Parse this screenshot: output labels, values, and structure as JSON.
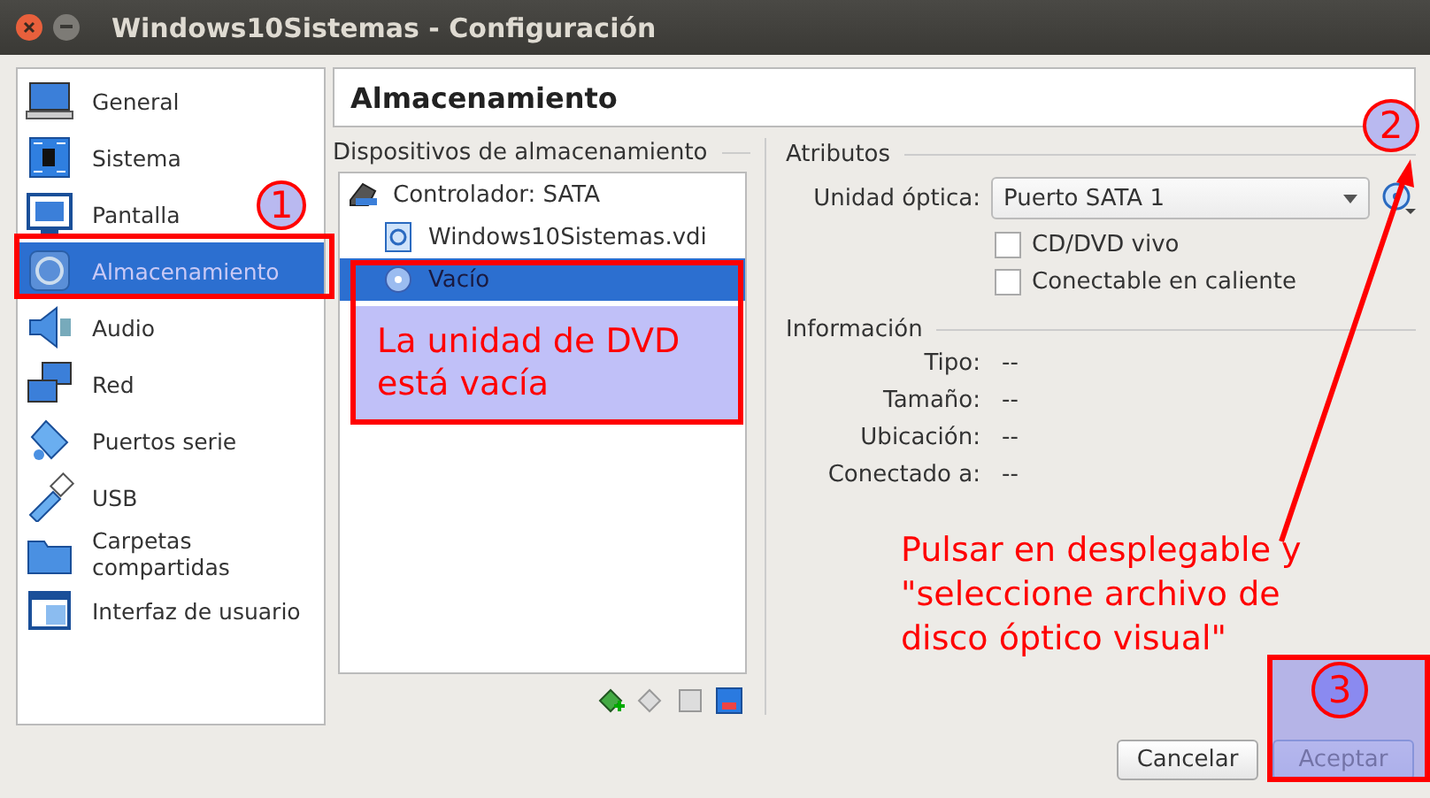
{
  "window": {
    "title": "Windows10Sistemas - Configuración"
  },
  "sidebar": {
    "items": [
      {
        "label": "General",
        "selected": false
      },
      {
        "label": "Sistema",
        "selected": false
      },
      {
        "label": "Pantalla",
        "selected": false
      },
      {
        "label": "Almacenamiento",
        "selected": true
      },
      {
        "label": "Audio",
        "selected": false
      },
      {
        "label": "Red",
        "selected": false
      },
      {
        "label": "Puertos serie",
        "selected": false
      },
      {
        "label": "USB",
        "selected": false
      },
      {
        "label": "Carpetas compartidas",
        "selected": false
      },
      {
        "label": "Interfaz de usuario",
        "selected": false
      }
    ]
  },
  "page_title": "Almacenamiento",
  "storage": {
    "heading": "Dispositivos de almacenamiento",
    "tree": [
      {
        "label": "Controlador: SATA",
        "selected": false,
        "children": [
          {
            "label": "Windows10Sistemas.vdi",
            "kind": "disk",
            "selected": false
          },
          {
            "label": "Vacío",
            "kind": "optical",
            "selected": true
          }
        ]
      }
    ]
  },
  "attributes": {
    "heading": "Atributos",
    "optical_drive": {
      "label": "Unidad óptica:",
      "value": "Puerto SATA 1"
    },
    "checkboxes": [
      {
        "label": "CD/DVD vivo",
        "checked": false
      },
      {
        "label": "Conectable en caliente",
        "checked": false
      }
    ]
  },
  "information": {
    "heading": "Información",
    "rows": [
      {
        "label": "Tipo:",
        "value": "--"
      },
      {
        "label": "Tamaño:",
        "value": "--"
      },
      {
        "label": "Ubicación:",
        "value": "--"
      },
      {
        "label": "Conectado a:",
        "value": "--"
      }
    ]
  },
  "buttons": [
    {
      "label": "Cancelar",
      "kind": "normal"
    },
    {
      "label": "Aceptar",
      "kind": "default"
    }
  ],
  "annotations": {
    "markers": [
      "1",
      "2",
      "3"
    ],
    "note": "La unidad de DVD está vacía",
    "instruction": "Pulsar en desplegable y \"seleccione archivo de disco óptico visual\""
  }
}
